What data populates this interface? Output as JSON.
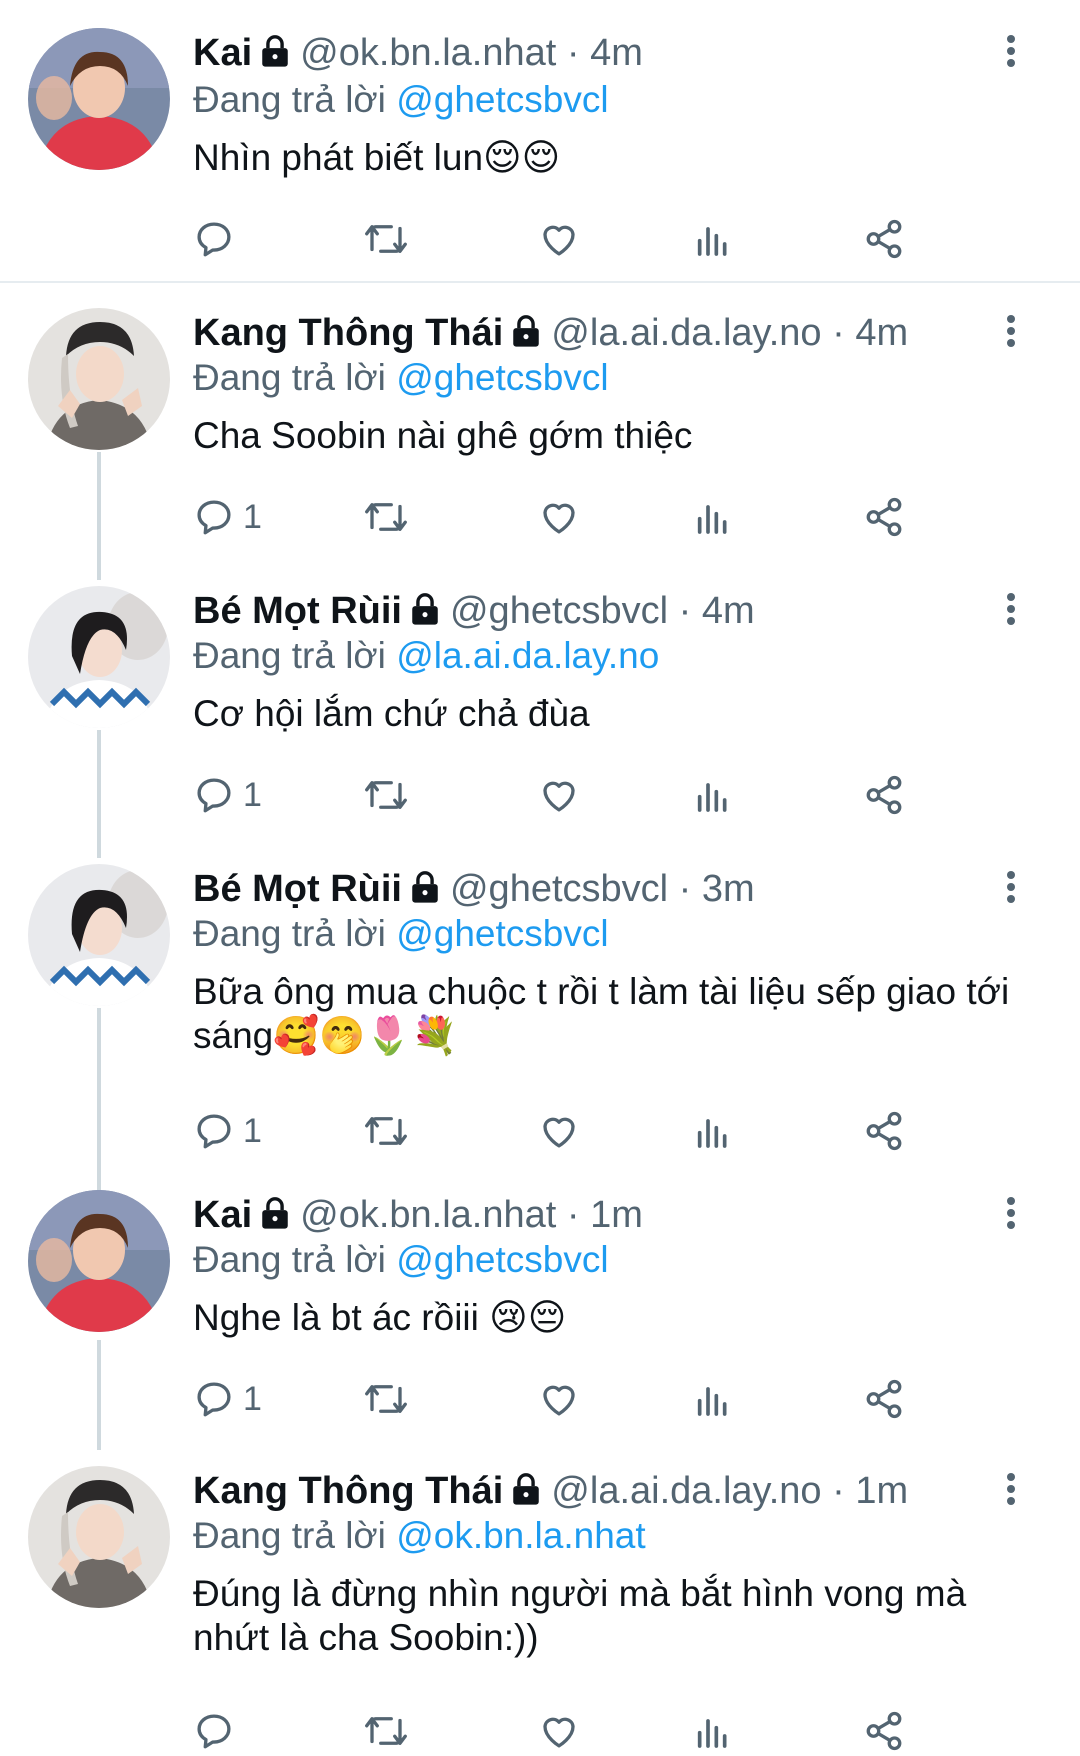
{
  "tweets": [
    {
      "name": "Kai",
      "handle": "@ok.bn.la.nhat",
      "time": "4m",
      "reply_prefix": "Đang trả lời",
      "reply_to": "@ghetcsbvcl",
      "text": "Nhìn phát biết lun😌😌",
      "reply_count": "",
      "avatar_theme": "red-shirt"
    },
    {
      "name": "Kang Thông Thái",
      "handle": "@la.ai.da.lay.no",
      "time": "4m",
      "reply_prefix": "Đang trả lời",
      "reply_to": "@ghetcsbvcl",
      "text": "Cha Soobin nài ghê gớm thiệc",
      "reply_count": "1",
      "avatar_theme": "hat-grey"
    },
    {
      "name": "Bé Mọt Rùii",
      "handle": "@ghetcsbvcl",
      "time": "4m",
      "reply_prefix": "Đang trả lời",
      "reply_to": "@la.ai.da.lay.no",
      "text": "Cơ hội lắm chứ chả đùa",
      "reply_count": "1",
      "avatar_theme": "blue-sweater"
    },
    {
      "name": "Bé Mọt Rùii",
      "handle": "@ghetcsbvcl",
      "time": "3m",
      "reply_prefix": "Đang trả lời",
      "reply_to": "@ghetcsbvcl",
      "text": "Bữa ông mua chuộc t rồi t làm tài liệu sếp giao tới sáng🥰🤭🌷💐",
      "reply_count": "1",
      "avatar_theme": "blue-sweater"
    },
    {
      "name": "Kai",
      "handle": "@ok.bn.la.nhat",
      "time": "1m",
      "reply_prefix": "Đang trả lời",
      "reply_to": "@ghetcsbvcl",
      "text": "Nghe là bt ác rồiii 😢😔",
      "reply_count": "1",
      "avatar_theme": "red-shirt"
    },
    {
      "name": "Kang Thông Thái",
      "handle": "@la.ai.da.lay.no",
      "time": "1m",
      "reply_prefix": "Đang trả lời",
      "reply_to": "@ok.bn.la.nhat",
      "text": "Đúng là đừng nhìn người mà bắt hình vong mà nhứt là cha Soobin:))",
      "reply_count": "",
      "avatar_theme": "hat-grey"
    }
  ],
  "separator": "·",
  "icons": {
    "lock": "lock-icon",
    "more": "more-vertical-icon",
    "reply": "reply-icon",
    "retweet": "retweet-icon",
    "like": "heart-icon",
    "views": "views-icon",
    "share": "share-icon"
  },
  "colors": {
    "text": "#0f1419",
    "secondary": "#536471",
    "mention": "#1d9bf0",
    "thread_line": "#cfd9de",
    "divider": "#e6ecf0"
  }
}
